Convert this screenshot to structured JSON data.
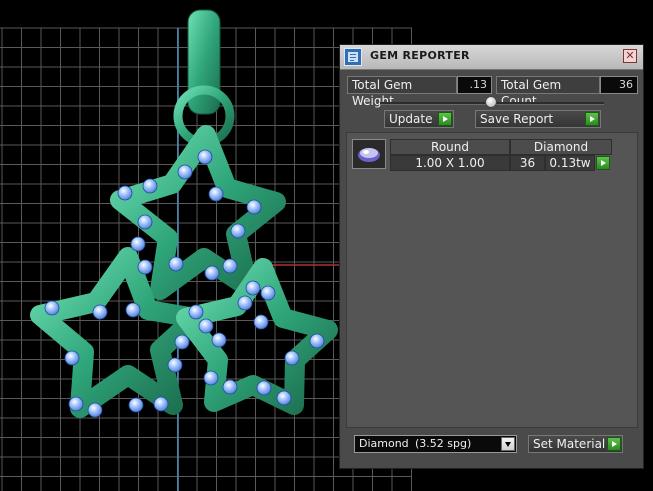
{
  "colors": {
    "grid": "#5a5a5a",
    "metal": "#2fa57a",
    "gem": "#8fb8ff",
    "accent": "#4aa93a"
  },
  "panel": {
    "title": "GEM REPORTER",
    "close_icon": "close-icon",
    "total_weight_label": "Total Gem Weight",
    "total_weight_value": ".13",
    "total_count_label": "Total Gem Count",
    "total_count_value": "36",
    "update_label": "Update",
    "save_report_label": "Save Report",
    "columns": [
      "Round",
      "Diamond"
    ],
    "rows": [
      {
        "size": "1.00 X 1.00",
        "count": "36",
        "weight": "0.13tw"
      }
    ],
    "material_select": {
      "name": "Diamond",
      "spg": "(3.52 spg)"
    },
    "set_material_label": "Set Material"
  }
}
